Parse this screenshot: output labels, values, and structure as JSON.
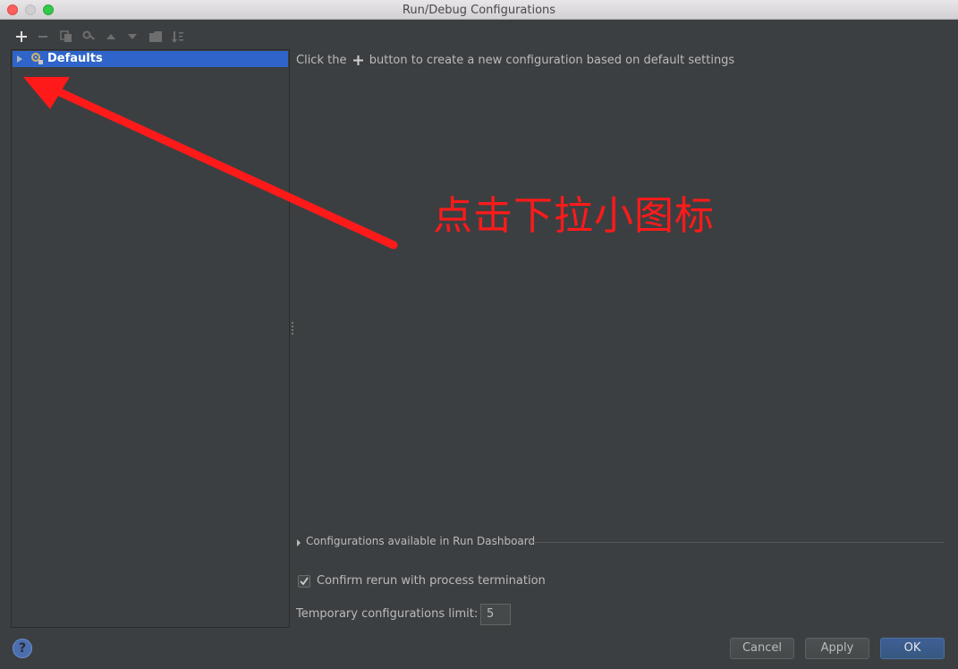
{
  "window": {
    "title": "Run/Debug Configurations"
  },
  "toolbar": {
    "icons": [
      "add-icon",
      "remove-icon",
      "copy-icon",
      "edit-defaults-icon",
      "move-up-icon",
      "move-down-icon",
      "folder-icon",
      "sort-icon"
    ]
  },
  "tree": {
    "items": [
      {
        "label": "Defaults",
        "icon": "defaults-gear-icon",
        "selected": true,
        "expanded": false
      }
    ]
  },
  "main": {
    "hint_prefix": "Click the",
    "hint_suffix": "button to create a new configuration based on default settings",
    "annotation": "点击下拉小图标",
    "dashboard_label": "Configurations available in Run Dashboard",
    "confirm_rerun_label": "Confirm rerun with process termination",
    "confirm_rerun_checked": true,
    "temp_limit_label": "Temporary configurations limit:",
    "temp_limit_value": "5"
  },
  "footer": {
    "help_label": "?",
    "cancel_label": "Cancel",
    "apply_label": "Apply",
    "ok_label": "OK"
  },
  "colors": {
    "background": "#3c3f41",
    "selection": "#2f65ca",
    "annotation": "#ff1a1a",
    "ok_button": "#365880"
  }
}
